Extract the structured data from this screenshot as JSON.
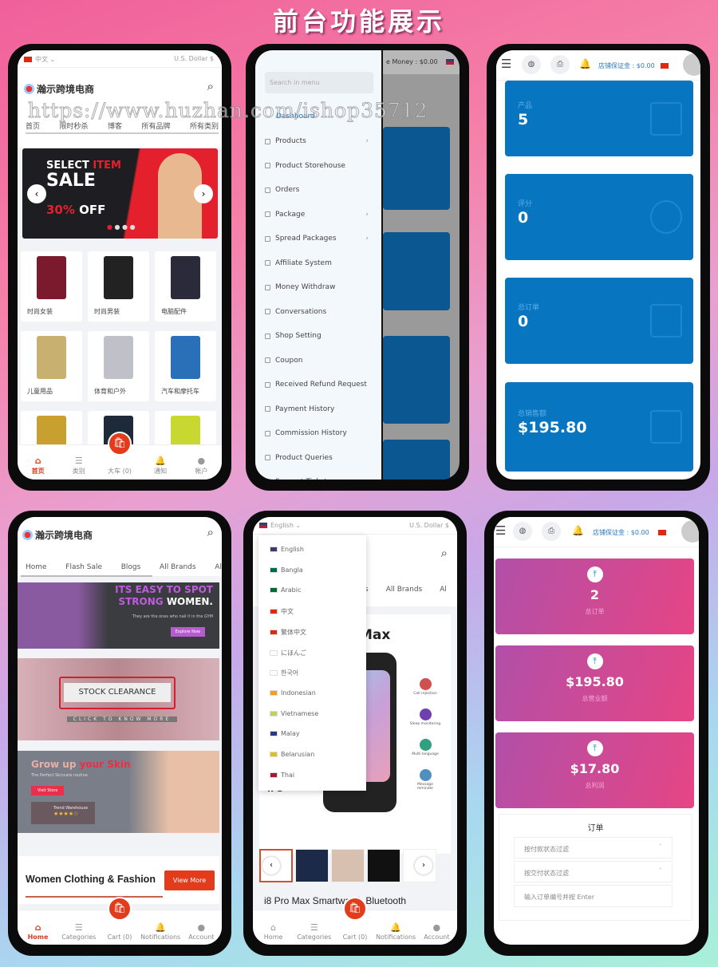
{
  "title": "前台功能展示",
  "watermark": "https://www.huzhan.com/ishop35712",
  "colors": {
    "accent": "#e23c1c",
    "seller_blue": "#0775c0",
    "pink_start": "#b24fa8",
    "pink_end": "#e64584"
  },
  "phone1": {
    "language": "中文",
    "currency": "U.S. Dollar $",
    "logo_text": "瀚示跨境电商",
    "nav": [
      "首页",
      "限时秒杀",
      "博客",
      "所有品牌",
      "所有类别"
    ],
    "banner": {
      "line1a": "SELECT",
      "line1b": "ITEM",
      "line2": "SALE",
      "discount": "30%",
      "off": "OFF"
    },
    "categories": [
      {
        "label": "时尚女装",
        "color": "#7a1a2c"
      },
      {
        "label": "时尚男装",
        "color": "#222"
      },
      {
        "label": "电脑配件",
        "color": "#2a2a3a"
      },
      {
        "label": "儿童用品",
        "color": "#c8b070"
      },
      {
        "label": "体育和户外",
        "color": "#c0c0c8"
      },
      {
        "label": "汽车和摩托车",
        "color": "#2a70b8"
      },
      {
        "label": "",
        "color": "#c8a030"
      },
      {
        "label": "",
        "color": "#1e2a3a"
      },
      {
        "label": "",
        "color": "#c8d830"
      }
    ],
    "bottom_nav": [
      "首页",
      "类别",
      "大车 (0)",
      "通知",
      "帐户"
    ]
  },
  "phone2": {
    "money": "e Money : $0.00",
    "search_placeholder": "Search in menu",
    "active": "Dashboard",
    "menu": [
      {
        "label": "Products",
        "sub": true
      },
      {
        "label": "Product Storehouse"
      },
      {
        "label": "Orders"
      },
      {
        "label": "Package",
        "sub": true
      },
      {
        "label": "Spread Packages",
        "sub": true
      },
      {
        "label": "Affiliate System"
      },
      {
        "label": "Money Withdraw"
      },
      {
        "label": "Conversations"
      },
      {
        "label": "Shop Setting"
      },
      {
        "label": "Coupon"
      },
      {
        "label": "Received Refund Request"
      },
      {
        "label": "Payment History"
      },
      {
        "label": "Commission History"
      },
      {
        "label": "Product Queries"
      },
      {
        "label": "Support Ticket"
      }
    ]
  },
  "phone3": {
    "deposit": "店铺保证金 : $0.00",
    "cards": [
      {
        "label": "产品",
        "value": "5",
        "icon": "box-icon"
      },
      {
        "label": "评分",
        "value": "0",
        "icon": "star-icon"
      },
      {
        "label": "总订单",
        "value": "0",
        "icon": "clipboard-icon"
      },
      {
        "label": "总销售额",
        "value": "$195.80",
        "icon": "chart-icon"
      }
    ]
  },
  "phone4": {
    "logo_text": "瀚示跨境电商",
    "nav": [
      "Home",
      "Flash Sale",
      "Blogs",
      "All Brands",
      "Al"
    ],
    "banner1": {
      "a": "ITS EASY TO SPOT",
      "b": "STRONG",
      "c": "WOMEN.",
      "sub": "They are the ones who nail it in the GYM",
      "btn": "Explore Now"
    },
    "banner2": {
      "a": "STOCK CLEARANCE",
      "b": "CLICK TO KNOW MORE"
    },
    "banner3": {
      "a": "Grow up",
      "b": "your Skin",
      "sub": "The Perfect Skincare routine",
      "btn": "Visit Store",
      "badge": "Trend Warehouse"
    },
    "section_title": "Women Clothing & Fashion",
    "view_more": "View More",
    "bottom_nav": [
      "Home",
      "Categories",
      "Cart (0)",
      "Notifications",
      "Account"
    ]
  },
  "phone5": {
    "language": "English",
    "currency": "U.S. Dollar $",
    "languages": [
      {
        "label": "English",
        "flag": "#3c3b6e"
      },
      {
        "label": "Bangla",
        "flag": "#006a4e"
      },
      {
        "label": "Arabic",
        "flag": "#006c35"
      },
      {
        "label": "中文",
        "flag": "#de2910"
      },
      {
        "label": "繁体中文",
        "flag": "#de2910"
      },
      {
        "label": "にほんご",
        "flag": "#fff"
      },
      {
        "label": "한국어",
        "flag": "#fff"
      },
      {
        "label": "Indonesian",
        "flag": "#f0a020"
      },
      {
        "label": "Vietnamese",
        "flag": "#c0d060"
      },
      {
        "label": "Malay",
        "flag": "#2a3a80"
      },
      {
        "label": "Belarusian",
        "flag": "#e0c020"
      },
      {
        "label": "Thai",
        "flag": "#a51931"
      }
    ],
    "nav_visible": [
      "s",
      "All Brands",
      "Al"
    ],
    "product_heading": "Max",
    "features": [
      "Call rejection",
      "Sleep monitoring",
      "Multi-language",
      "Message reminder"
    ],
    "ips": "IPS",
    "product_title": "i8 Pro Max Smartwatch Bluetooth",
    "bottom_nav": [
      "Home",
      "Categories",
      "Cart (0)",
      "Notifications",
      "Account"
    ]
  },
  "phone6": {
    "deposit": "店铺保证金 : $0.00",
    "cards": [
      {
        "value": "2",
        "label": "总订单"
      },
      {
        "value": "$195.80",
        "label": "总营业额"
      },
      {
        "value": "$17.80",
        "label": "总利润"
      }
    ],
    "orders_title": "订单",
    "filters": [
      "按付款状态过滤",
      "按交付状态过滤"
    ],
    "order_search_placeholder": "输入订单编号并按 Enter"
  }
}
